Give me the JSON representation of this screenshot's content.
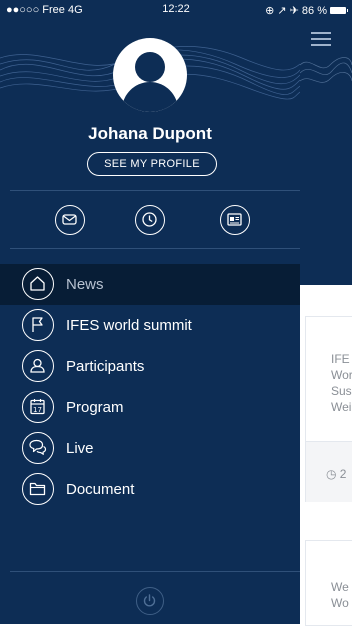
{
  "status_bar": {
    "carrier": "●●○○○ Free  4G",
    "time": "12:22",
    "indicators": "⊕ ↗ ✈ 86 %",
    "icons": [
      "signal-dots-icon",
      "location-icon",
      "alarm-icon",
      "battery-icon"
    ]
  },
  "profile": {
    "name": "Johana Dupont",
    "see_profile_label": "SEE MY PROFILE",
    "avatar_icon": "user-avatar-icon"
  },
  "quick_actions": [
    {
      "name": "mail",
      "icon": "mail-icon"
    },
    {
      "name": "clock",
      "icon": "clock-icon"
    },
    {
      "name": "badge",
      "icon": "id-badge-icon"
    }
  ],
  "menu": {
    "items": [
      {
        "label": "News",
        "icon": "home-icon",
        "active": true
      },
      {
        "label": "IFES world summit",
        "icon": "flag-icon",
        "active": false
      },
      {
        "label": "Participants",
        "icon": "person-icon",
        "active": false
      },
      {
        "label": "Program",
        "icon": "calendar-icon",
        "calendar_day": "17",
        "active": false
      },
      {
        "label": "Live",
        "icon": "chat-bubbles-icon",
        "active": false
      },
      {
        "label": "Document",
        "icon": "folder-icon",
        "active": false
      }
    ]
  },
  "footer": {
    "power_icon": "power-icon"
  },
  "background": {
    "hamburger_icon": "hamburger-menu-icon",
    "card1_lines": [
      "IFE",
      "Wor",
      "Sus",
      "Wei"
    ],
    "card1_date": "◷ 2",
    "card2_lines": [
      "We",
      "Wo"
    ]
  },
  "colors": {
    "drawer_bg": "#0d2d55",
    "active_item_bg": "#071d36",
    "accent_white": "#ffffff"
  }
}
